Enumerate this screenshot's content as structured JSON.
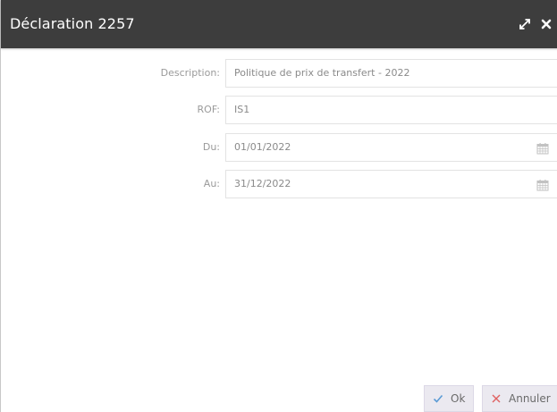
{
  "dialog": {
    "title": "Déclaration 2257",
    "title_icons": [
      "expand-icon",
      "close-icon"
    ]
  },
  "form": {
    "description": {
      "label": "Description:",
      "value": "Politique de prix de transfert - 2022"
    },
    "rof": {
      "label": "ROF:",
      "value": "IS1"
    },
    "from_date": {
      "label": "Du:",
      "value": "01/01/2022",
      "icon": "calendar-icon"
    },
    "to_date": {
      "label": "Au:",
      "value": "31/12/2022",
      "icon": "calendar-icon"
    }
  },
  "footer": {
    "ok_label": "Ok",
    "ok_icon": "check-icon",
    "cancel_label": "Annuler",
    "cancel_icon": "x-icon"
  },
  "colors": {
    "titlebar_bg": "#3d3d3d",
    "ok_check": "#5b9bd5",
    "cancel_x": "#e06060",
    "button_bg": "#ebe9f0"
  }
}
